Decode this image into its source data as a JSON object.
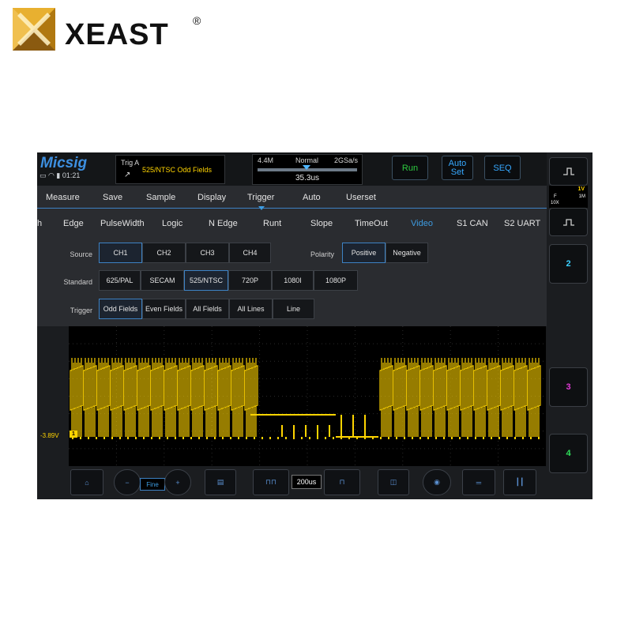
{
  "logo": {
    "text": "XEAST",
    "reg_mark": "®",
    "colors": {
      "mark_gold": "#e0a020",
      "mark_dark": "#6a4a10",
      "text": "#111111"
    }
  },
  "topbar": {
    "brand": "Micsig",
    "time": "01:21",
    "status_icons": [
      "display-icon",
      "wifi-icon",
      "battery-icon"
    ],
    "trigger_box": {
      "label": "Trig A",
      "mode": "525/NTSC Odd Fields"
    },
    "timebase_box": {
      "memory_depth": "4.4M",
      "acq_mode": "Normal",
      "sample_rate": "2GSa/s",
      "position": "35.3us"
    },
    "buttons": {
      "run": "Run",
      "auto_line1": "Auto",
      "auto_line2": "Set",
      "seq": "SEQ"
    }
  },
  "right_column": {
    "ch1": {
      "volts": "1V",
      "coupling": "F",
      "impedance": "1M",
      "probe": "10X"
    },
    "ch2_label": "2",
    "ch3_label": "3",
    "ch4_label": "4",
    "colors": {
      "ch1": "#ffd400",
      "ch2": "#3ad0ff",
      "ch3": "#e23bd6",
      "ch4": "#2ee05a"
    }
  },
  "menu": {
    "items": [
      "Measure",
      "Save",
      "Sample",
      "Display",
      "Trigger",
      "Auto",
      "Userset"
    ],
    "active": "Trigger"
  },
  "trigger_types": {
    "leading_fragment": "h",
    "items": [
      "Edge",
      "PulseWidth",
      "Logic",
      "N Edge",
      "Runt",
      "Slope",
      "TimeOut",
      "Video",
      "S1 CAN",
      "S2 UART"
    ],
    "active": "Video"
  },
  "options": {
    "source": {
      "label": "Source",
      "values": [
        "CH1",
        "CH2",
        "CH3",
        "CH4"
      ],
      "selected": "CH1"
    },
    "polarity": {
      "label": "Polarity",
      "values": [
        "Positive",
        "Negative"
      ],
      "selected": "Positive"
    },
    "standard": {
      "label": "Standard",
      "values": [
        "625/PAL",
        "SECAM",
        "525/NTSC",
        "720P",
        "1080I",
        "1080P"
      ],
      "selected": "525/NTSC"
    },
    "trigger": {
      "label": "Trigger",
      "values": [
        "Odd Fields",
        "Even Fields",
        "All Fields",
        "All Lines",
        "Line"
      ],
      "selected": "Odd Fields"
    }
  },
  "screen": {
    "trigger_level": "-3.89V",
    "channel_marker": "1",
    "trace_color": "#ffd400"
  },
  "bottom_bar": {
    "fine_label": "Fine",
    "timebase": "200us",
    "buttons": [
      "home-icon",
      "vertical-scale-knob",
      "save-file-icon",
      "timebase-left-icon",
      "timebase-right-icon",
      "zoom-button",
      "measure-button",
      "menu-lines-icon",
      "cursor-icon"
    ]
  },
  "colors": {
    "accent_blue": "#3d9be0",
    "run_green": "#2ecc40",
    "panel_bg": "#2a2c30"
  }
}
